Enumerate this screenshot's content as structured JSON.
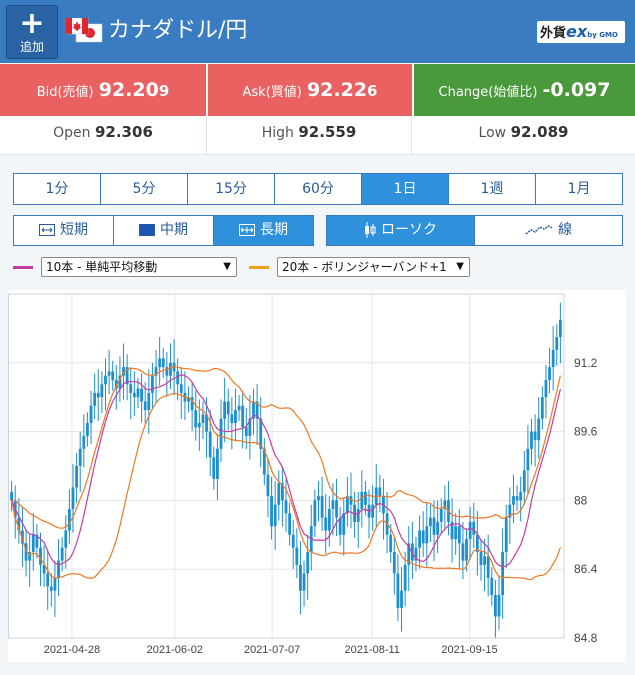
{
  "header": {
    "add_label": "追加",
    "add_icon": "plus-icon",
    "pair_title": "カナダドル/円",
    "logo_main": "外貨",
    "logo_ex": "ex",
    "logo_sub": "by GMO"
  },
  "prices": {
    "bid_label": "Bid(売値)",
    "bid_main": "92.20",
    "bid_pip": "9",
    "ask_label": "Ask(買値)",
    "ask_main": "92.22",
    "ask_pip": "6",
    "change_label": "Change(始値比)",
    "change_value": "-0.097",
    "bid_bg": "#e96161",
    "change_bg": "#4a9a3c"
  },
  "ohl": {
    "open_label": "Open",
    "open_main": "92.30",
    "open_pip": "6",
    "high_label": "High",
    "high_main": "92.55",
    "high_pip": "9",
    "low_label": "Low",
    "low_main": "92.08",
    "low_pip": "9"
  },
  "timeframes": [
    {
      "label": "1分",
      "active": false
    },
    {
      "label": "5分",
      "active": false
    },
    {
      "label": "15分",
      "active": false
    },
    {
      "label": "60分",
      "active": false
    },
    {
      "label": "1日",
      "active": true
    },
    {
      "label": "1週",
      "active": false
    },
    {
      "label": "1月",
      "active": false
    }
  ],
  "terms": [
    {
      "label": "短期",
      "active": false
    },
    {
      "label": "中期",
      "active": false
    },
    {
      "label": "長期",
      "active": true
    }
  ],
  "chart_types": [
    {
      "label": "ローソク",
      "active": true
    },
    {
      "label": "線",
      "active": false
    }
  ],
  "indicators": {
    "ma_label": "10本 - 単純平均移動",
    "ma_color": "#c83ca0",
    "bb_label": "20本 - ボリンジャーバンド+1",
    "bb_color": "#f0a020"
  },
  "chart_data": {
    "type": "candlestick",
    "ylim": [
      84.8,
      92.8
    ],
    "y_ticks": [
      "91.2",
      "89.6",
      "88",
      "86.4",
      "84.8"
    ],
    "x_ticks": [
      "2021-04-28",
      "2021-06-02",
      "2021-07-07",
      "2021-08-11",
      "2021-09-15"
    ],
    "candle_color": "#1d8fcf",
    "ma_color": "#c83ca0",
    "band_color": "#f07820",
    "close_series": [
      88.0,
      87.6,
      87.3,
      87.0,
      86.6,
      86.8,
      87.2,
      86.9,
      86.5,
      86.3,
      86.0,
      85.9,
      86.2,
      86.6,
      86.9,
      87.3,
      87.8,
      88.3,
      88.8,
      89.2,
      89.5,
      89.8,
      90.2,
      90.5,
      90.4,
      90.7,
      90.9,
      91.0,
      90.8,
      90.6,
      90.9,
      91.1,
      90.7,
      90.5,
      90.4,
      90.6,
      90.3,
      90.1,
      90.5,
      90.9,
      91.1,
      91.3,
      91.1,
      90.9,
      91.2,
      91.0,
      90.7,
      90.5,
      90.3,
      90.4,
      90.1,
      89.7,
      89.8,
      90.0,
      89.6,
      89.0,
      88.5,
      89.2,
      89.9,
      90.3,
      90.0,
      89.8,
      90.1,
      90.2,
      89.7,
      89.5,
      89.9,
      90.3,
      89.9,
      89.2,
      88.6,
      88.1,
      87.4,
      87.9,
      88.4,
      88.0,
      87.7,
      87.2,
      86.9,
      86.5,
      85.9,
      86.3,
      86.8,
      87.4,
      88.0,
      88.1,
      87.6,
      87.3,
      87.8,
      88.0,
      87.6,
      87.2,
      87.7,
      88.1,
      87.9,
      87.5,
      87.8,
      88.2,
      87.9,
      87.6,
      87.9,
      88.3,
      88.1,
      87.7,
      87.2,
      86.8,
      86.3,
      85.5,
      85.9,
      86.5,
      87.0,
      86.6,
      86.9,
      87.3,
      87.0,
      87.4,
      87.6,
      87.2,
      87.5,
      87.8,
      88.0,
      87.5,
      87.1,
      87.4,
      87.0,
      86.6,
      87.1,
      87.5,
      87.2,
      86.8,
      86.5,
      86.7,
      86.2,
      85.8,
      85.3,
      85.8,
      86.8,
      87.6,
      87.9,
      88.1,
      88.0,
      88.2,
      88.7,
      89.2,
      89.6,
      89.4,
      89.9,
      90.4,
      90.8,
      91.1,
      91.5,
      91.8,
      92.2
    ]
  }
}
